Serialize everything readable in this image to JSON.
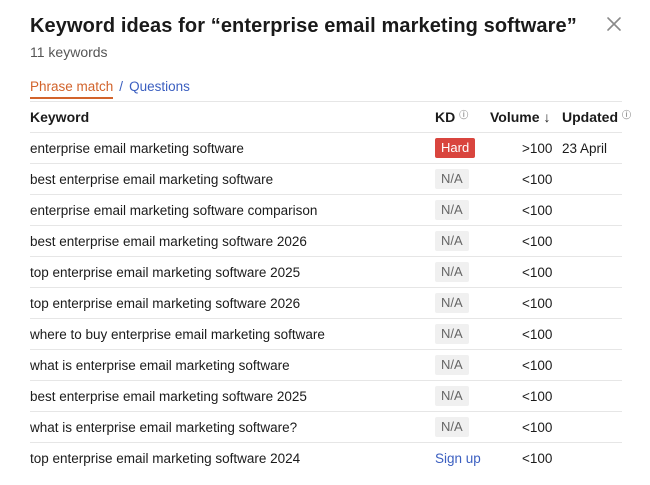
{
  "header": {
    "title": "Keyword ideas for “enterprise email marketing software”",
    "subtitle": "11 keywords"
  },
  "tabs": {
    "active": "Phrase match",
    "separator": "/",
    "other": "Questions"
  },
  "table": {
    "columns": {
      "keyword": "Keyword",
      "kd": "KD",
      "volume": "Volume",
      "updated": "Updated"
    },
    "rows": [
      {
        "keyword": "enterprise email marketing software",
        "kd": "Hard",
        "volume": ">100",
        "updated": "23 April"
      },
      {
        "keyword": "best enterprise email marketing software",
        "kd": "N/A",
        "volume": "<100",
        "updated": ""
      },
      {
        "keyword": "enterprise email marketing software comparison",
        "kd": "N/A",
        "volume": "<100",
        "updated": ""
      },
      {
        "keyword": "best enterprise email marketing software 2026",
        "kd": "N/A",
        "volume": "<100",
        "updated": ""
      },
      {
        "keyword": "top enterprise email marketing software 2025",
        "kd": "N/A",
        "volume": "<100",
        "updated": ""
      },
      {
        "keyword": "top enterprise email marketing software 2026",
        "kd": "N/A",
        "volume": "<100",
        "updated": ""
      },
      {
        "keyword": "where to buy enterprise email marketing software",
        "kd": "N/A",
        "volume": "<100",
        "updated": ""
      },
      {
        "keyword": "what is enterprise email marketing software",
        "kd": "N/A",
        "volume": "<100",
        "updated": ""
      },
      {
        "keyword": "best enterprise email marketing software 2025",
        "kd": "N/A",
        "volume": "<100",
        "updated": ""
      },
      {
        "keyword": "what is enterprise email marketing software?",
        "kd": "N/A",
        "volume": "<100",
        "updated": ""
      },
      {
        "keyword": "top enterprise email marketing software 2024",
        "kd": "Sign up",
        "volume": "<100",
        "updated": ""
      }
    ]
  },
  "colors": {
    "accent_orange": "#d2632b",
    "link_blue": "#3b5fc0",
    "hard_red": "#d9453e"
  }
}
